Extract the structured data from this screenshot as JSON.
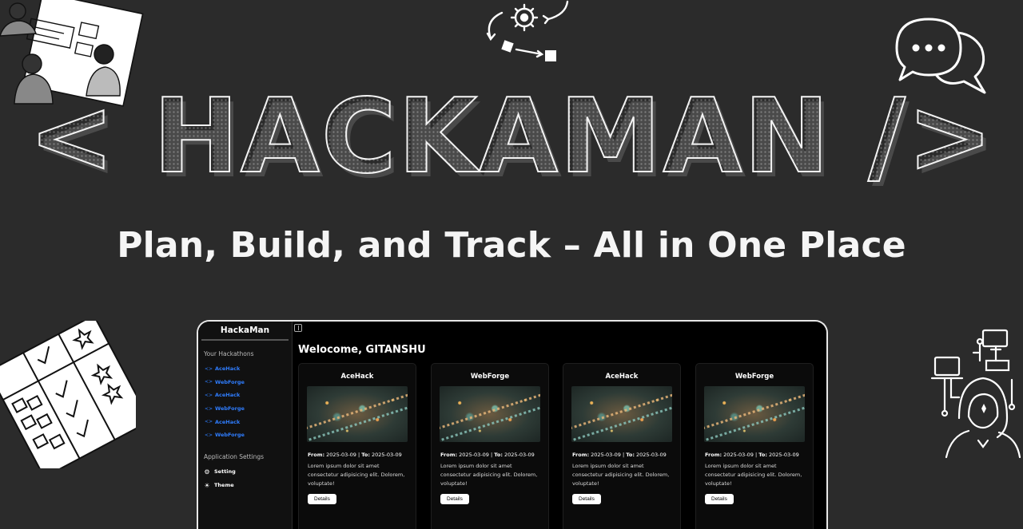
{
  "hero": {
    "logo": "< HACKAMAN />",
    "tagline": "Plan, Build, and Track – All in One Place"
  },
  "icons": {
    "top_left": "team-collaboration-illustration",
    "top_center": "workflow-gear-icon",
    "top_right": "chat-bubbles-icon",
    "bottom_left": "checklist-board-illustration",
    "bottom_right": "hacker-network-illustration"
  },
  "app": {
    "brand": "HackaMan",
    "sidebar": {
      "hackathons_heading": "Your Hackathons",
      "items": [
        {
          "label": "AceHack",
          "icon": "code-icon"
        },
        {
          "label": "WebForge",
          "icon": "code-icon"
        },
        {
          "label": "AceHack",
          "icon": "code-icon"
        },
        {
          "label": "WebForge",
          "icon": "code-icon"
        },
        {
          "label": "AceHack",
          "icon": "code-icon"
        },
        {
          "label": "WebForge",
          "icon": "code-icon"
        }
      ],
      "settings_heading": "Application Settings",
      "settings": [
        {
          "label": "Setting",
          "icon": "gear-icon",
          "glyph": "⚙"
        },
        {
          "label": "Theme",
          "icon": "sun-icon",
          "glyph": "☀"
        }
      ]
    },
    "welcome": "Welocome, GITANSHU",
    "cards": [
      {
        "title": "AceHack",
        "from_label": "From:",
        "from": "2025-03-09",
        "sep": "|",
        "to_label": "To:",
        "to": "2025-03-09",
        "desc": "Lorem ipsum dolor sit amet consectetur adipisicing elit. Dolorem, voluptate!",
        "button": "Details"
      },
      {
        "title": "WebForge",
        "from_label": "From:",
        "from": "2025-03-09",
        "sep": "|",
        "to_label": "To:",
        "to": "2025-03-09",
        "desc": "Lorem ipsum dolor sit amet consectetur adipisicing elit. Dolorem, voluptate!",
        "button": "Details"
      },
      {
        "title": "AceHack",
        "from_label": "From:",
        "from": "2025-03-09",
        "sep": "|",
        "to_label": "To:",
        "to": "2025-03-09",
        "desc": "Lorem ipsum dolor sit amet consectetur adipisicing elit. Dolorem, voluptate!",
        "button": "Details"
      },
      {
        "title": "WebForge",
        "from_label": "From:",
        "from": "2025-03-09",
        "sep": "|",
        "to_label": "To:",
        "to": "2025-03-09",
        "desc": "Lorem ipsum dolor sit amet consectetur adipisicing elit. Dolorem, voluptate!",
        "button": "Details"
      }
    ]
  },
  "colors": {
    "background": "#2b2b2b",
    "app_background": "#000000",
    "link_blue": "#2f7dff",
    "text": "#ffffff"
  }
}
